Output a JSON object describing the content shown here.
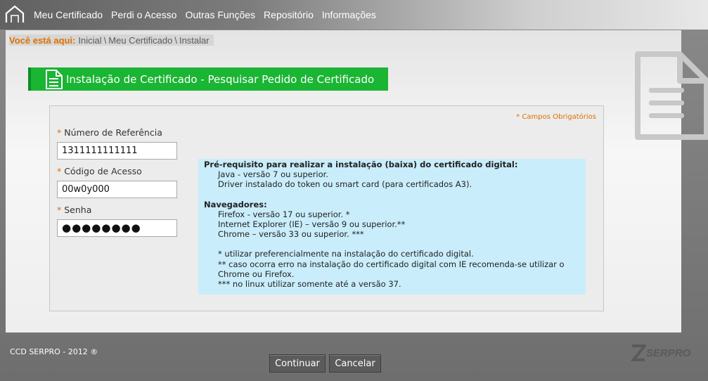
{
  "nav": {
    "items": [
      "Meu Certificado",
      "Perdi o Acesso",
      "Outras Funções",
      "Repositório",
      "Informações"
    ]
  },
  "breadcrumb": {
    "label": "Você está aqui:",
    "items": [
      "Inicial",
      "Meu Certificado"
    ],
    "current": "Instalar"
  },
  "title": "Instalação de Certificado - Pesquisar Pedido de Certificado",
  "form": {
    "required_note": "* Campos Obrigatórios",
    "fields": [
      {
        "label": "Número de Referência",
        "value": "1311111111111"
      },
      {
        "label": "Código de Acesso",
        "value": "00w0y000"
      },
      {
        "label": "Senha",
        "value": "●●●●●●●●"
      }
    ]
  },
  "info": {
    "prereq_title": "Pré-requisito para realizar a instalação (baixa) do certificado digital:",
    "prereq_lines": [
      "Java - versão 7 ou superior.",
      "Driver instalado do token ou smart card (para certificados A3)."
    ],
    "browsers_title": "Navegadores:",
    "browser_lines": [
      "Firefox - versão 17 ou superior. *",
      "Internet Explorer (IE) – versão 9 ou superior.**",
      "Chrome – versão 33 ou superior. ***"
    ],
    "notes": [
      "* utilizar preferencialmente na instalação do certificado digital.",
      "** caso ocorra erro na instalação do certificado digital com IE recomenda-se utilizar o",
      "Chrome ou Firefox.",
      "*** no linux utilizar somente até a versão 37."
    ]
  },
  "buttons": {
    "continue": "Continuar",
    "cancel": "Cancelar"
  },
  "footer": {
    "text": "CCD SERPRO - 2012 ®",
    "logo_text": "SERPRO"
  },
  "colors": {
    "green": "#1ab533",
    "orange": "#e07000",
    "info_bg": "#c9edfb"
  }
}
